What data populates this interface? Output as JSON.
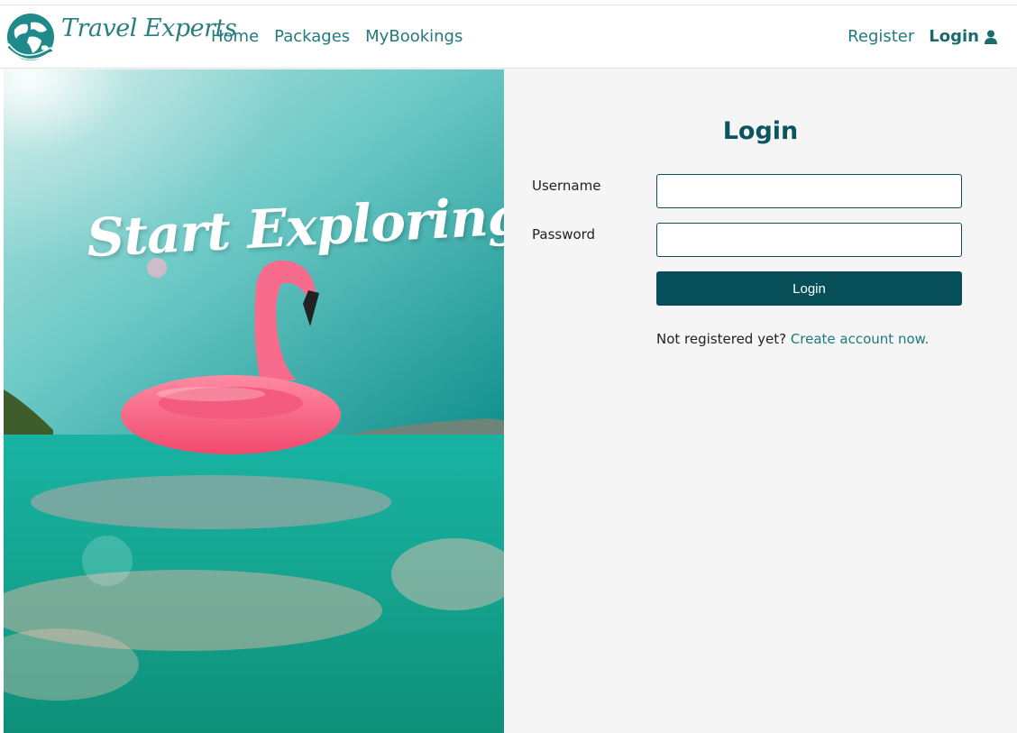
{
  "brand": {
    "name": "Travel Experts",
    "logo_icon": "globe-icon",
    "accent": "#227a7c"
  },
  "nav": {
    "links": [
      "Home",
      "Packages",
      "MyBookings"
    ],
    "register": "Register",
    "login": "Login",
    "login_icon": "user-icon"
  },
  "hero": {
    "title": "Start Exploring!"
  },
  "login_form": {
    "title": "Login",
    "username_label": "Username",
    "username_value": "",
    "password_label": "Password",
    "password_value": "",
    "submit_label": "Login",
    "signup_prompt": "Not registered yet?",
    "signup_link": "Create account now.",
    "button_color": "#064f59"
  }
}
